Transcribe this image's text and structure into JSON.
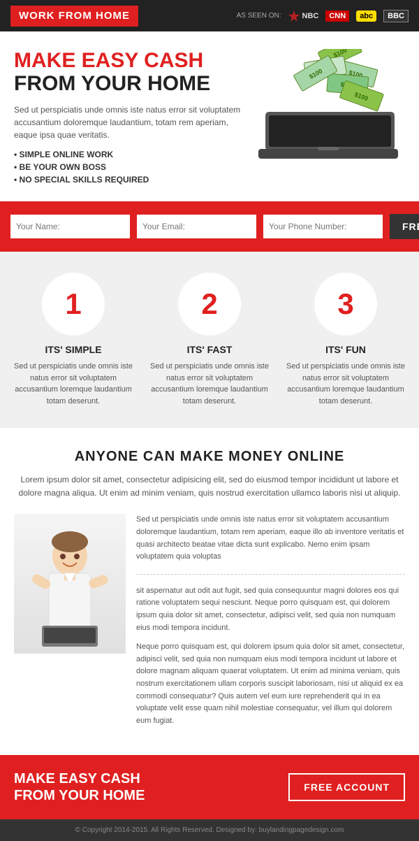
{
  "header": {
    "logo_text": "WORK FROM HOME",
    "as_seen_on": "AS SEEN ON:",
    "networks": [
      "NBC",
      "CNN",
      "abc",
      "BBC"
    ]
  },
  "hero": {
    "title_line1": "MAKE EASY CASH",
    "title_line2": "FROM YOUR HOME",
    "description": "Sed ut perspiciatis unde omnis iste natus error sit voluptatem accusantium doloremque laudantium, totam rem aperiam, eaque ipsa quae veritatis.",
    "bullets": [
      "SIMPLE ONLINE WORK",
      "BE YOUR OWN BOSS",
      "NO SPECIAL SKILLS REQUIRED"
    ]
  },
  "cta_bar": {
    "name_placeholder": "Your Name:",
    "email_placeholder": "Your Email:",
    "phone_placeholder": "Your Phone Number:",
    "button_label": "FREE ACCOUNT"
  },
  "steps": [
    {
      "number": "1",
      "title": "ITS' SIMPLE",
      "desc": "Sed ut perspiciatis unde omnis iste natus error sit voluptatem accusantium loremque laudantium totam deserunt."
    },
    {
      "number": "2",
      "title": "ITS' FAST",
      "desc": "Sed ut perspiciatis unde omnis iste natus error sit voluptatem accusantium loremque laudantium totam deserunt."
    },
    {
      "number": "3",
      "title": "ITS' FUN",
      "desc": "Sed ut perspiciatis unde omnis iste natus error sit voluptatem accusantium loremque laudantium totam deserunt."
    }
  ],
  "anyone": {
    "title": "ANYONE CAN MAKE MONEY ONLINE",
    "intro": "Lorem ipsum dolor sit amet, consectetur adipisicing elit, sed do eiusmod tempor incididunt ut labore et dolore magna aliqua. Ut enim ad minim veniam, quis nostrud exercitation ullamco laboris nisi ut aliquip.",
    "paragraphs": [
      "Sed ut perspiciatis unde omnis iste natus error sit voluptatem accusantium doloremque laudantium, totam rem aperiam, eaque illo ab inventore veritatis et quasi architecto beatae vitae dicta sunt explicabo. Nemo enim ipsam voluptatem quia voluptas",
      "sit aspernatur aut odit aut fugit, sed quia consequuntur magni dolores eos qui ratione voluptatem sequi nesciunt. Neque porro quisquam est, qui dolorem ipsum quia dolor sit amet, consectetur, adipisci velit, sed quia non numquam eius modi tempora incidunt.",
      "Neque porro quisquam est, qui dolorem ipsum quia dolor sit amet, consectetur, adipisci velit, sed quia non numquam eius modi tempora incidunt ut labore et dolore magnam aliquam quaerat voluptatem. Ut enim ad minima veniam, quis nostrum exercitationem ullam corporis suscipit laboriosam, nisi ut aliquid ex ea commodi consequatur? Quis autem vel eum iure reprehenderit qui in ea voluptate velit esse quam nihil molestiae consequatur, vel illum qui dolorem eum fugiat."
    ]
  },
  "bottom_cta": {
    "title_line1": "MAKE EASY CASH",
    "title_line2": "FROM YOUR HOME",
    "button_label": "FREE ACCOUNT"
  },
  "footer": {
    "text": "© Copyright 2014-2015. All Rights Reserved. Designed by: buylandingpagedesign.com"
  }
}
